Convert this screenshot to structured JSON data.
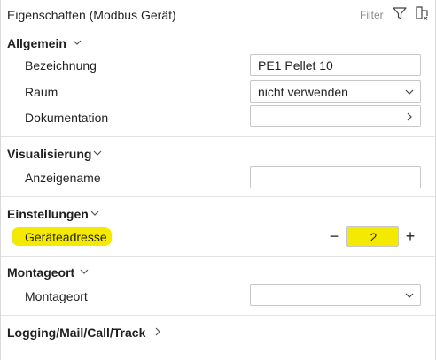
{
  "header": {
    "title": "Eigenschaften (Modbus Gerät)",
    "filter_label": "Filter",
    "filter_icon": "filter-icon",
    "clear_icon": "clear-filter-icon"
  },
  "sections": {
    "allgemein": {
      "title": "Allgemein",
      "rows": {
        "bezeichnung": {
          "label": "Bezeichnung",
          "value": "PE1 Pellet 10"
        },
        "raum": {
          "label": "Raum",
          "value": "nicht verwenden"
        },
        "dokumentation": {
          "label": "Dokumentation",
          "value": ""
        }
      }
    },
    "visualisierung": {
      "title": "Visualisierung",
      "rows": {
        "anzeigename": {
          "label": "Anzeigename",
          "value": ""
        }
      }
    },
    "einstellungen": {
      "title": "Einstellungen",
      "rows": {
        "geraeteadresse": {
          "label": "Geräteadresse",
          "value": "2",
          "minus": "−",
          "plus": "+"
        }
      }
    },
    "montageort": {
      "title": "Montageort",
      "rows": {
        "montageort": {
          "label": "Montageort",
          "value": ""
        }
      }
    },
    "logging": {
      "title": "Logging/Mail/Call/Track"
    }
  },
  "colors": {
    "highlight": "#f4e900",
    "border": "#c8c8c8",
    "divider": "#e2e2e2"
  }
}
